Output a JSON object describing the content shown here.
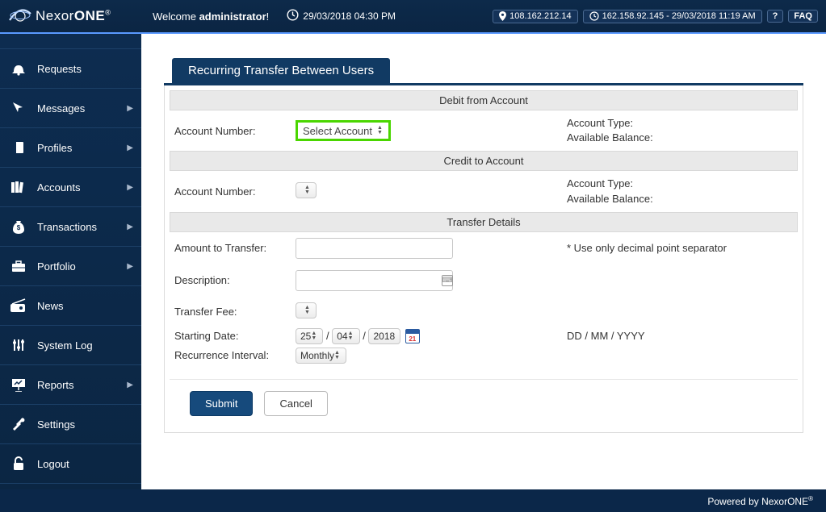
{
  "header": {
    "brand_prefix": "Nexor",
    "brand_suffix": "ONE",
    "brand_reg": "®",
    "welcome_prefix": "Welcome ",
    "welcome_user": "administrator",
    "welcome_suffix": "!",
    "datetime": "29/03/2018 04:30 PM",
    "ip_current": "108.162.212.14",
    "ip_last": "162.158.92.145 - 29/03/2018 11:19 AM",
    "help_label": "?",
    "faq_label": "FAQ"
  },
  "sidebar": {
    "items": [
      {
        "label": "Requests",
        "icon": "bell-icon",
        "chev": false
      },
      {
        "label": "Messages",
        "icon": "cursor-icon",
        "chev": true
      },
      {
        "label": "Profiles",
        "icon": "book-icon",
        "chev": true
      },
      {
        "label": "Accounts",
        "icon": "books-icon",
        "chev": true
      },
      {
        "label": "Transactions",
        "icon": "moneybag-icon",
        "chev": true
      },
      {
        "label": "Portfolio",
        "icon": "briefcase-icon",
        "chev": true
      },
      {
        "label": "News",
        "icon": "radio-icon",
        "chev": false
      },
      {
        "label": "System Log",
        "icon": "sliders-icon",
        "chev": false
      },
      {
        "label": "Reports",
        "icon": "presentation-icon",
        "chev": true
      },
      {
        "label": "Settings",
        "icon": "tools-icon",
        "chev": false
      },
      {
        "label": "Logout",
        "icon": "lock-icon",
        "chev": false
      }
    ]
  },
  "page": {
    "tab_title": "Recurring Transfer Between Users",
    "debit_section": "Debit from Account",
    "credit_section": "Credit to Account",
    "details_section": "Transfer Details",
    "labels": {
      "account_number": "Account Number:",
      "account_type": "Account Type:",
      "available_balance": "Available Balance:",
      "amount": "Amount to Transfer:",
      "amount_hint": "* Use only decimal point separator",
      "description": "Description:",
      "transfer_fee": "Transfer Fee:",
      "starting_date": "Starting Date:",
      "date_format": "DD / MM / YYYY",
      "recurrence": "Recurrence Interval:"
    },
    "debit_account_select": "Select Account",
    "date": {
      "day": "25",
      "month": "04",
      "year": "2018",
      "sep": "/"
    },
    "recurrence_value": "Monthly",
    "buttons": {
      "submit": "Submit",
      "cancel": "Cancel"
    }
  },
  "footer": {
    "powered_prefix": "Powered by ",
    "powered_brand": "NexorONE",
    "reg": "®"
  }
}
